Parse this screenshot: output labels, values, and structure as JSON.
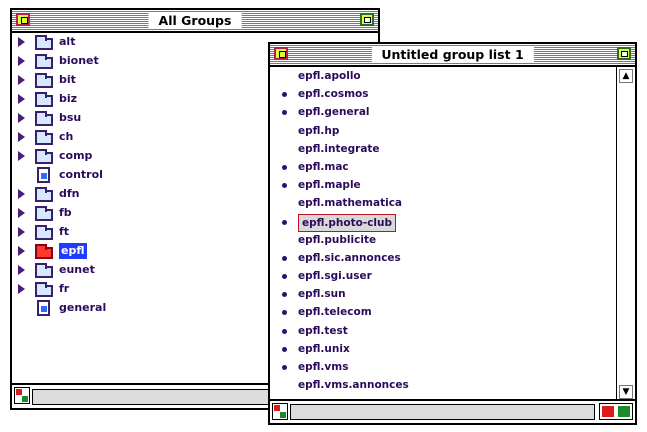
{
  "colors": {
    "list_text": "#2b0a5a",
    "selection_blue": "#1d3cff",
    "close_box_fill": "#d9ff3a",
    "folder_tint": "#d6e8ff",
    "red_folder": "#ff3a2a"
  },
  "all_groups_window": {
    "title": "All Groups",
    "items": [
      {
        "label": "alt",
        "icon": "folder-icon"
      },
      {
        "label": "bionet",
        "icon": "folder-icon"
      },
      {
        "label": "bit",
        "icon": "folder-icon"
      },
      {
        "label": "biz",
        "icon": "folder-icon"
      },
      {
        "label": "bsu",
        "icon": "folder-icon"
      },
      {
        "label": "ch",
        "icon": "folder-icon"
      },
      {
        "label": "comp",
        "icon": "folder-icon"
      },
      {
        "label": "control",
        "icon": "document-icon"
      },
      {
        "label": "dfn",
        "icon": "folder-icon"
      },
      {
        "label": "fb",
        "icon": "folder-icon"
      },
      {
        "label": "ft",
        "icon": "folder-icon"
      },
      {
        "label": "epfl",
        "icon": "folder-icon",
        "selected": true
      },
      {
        "label": "eunet",
        "icon": "folder-icon"
      },
      {
        "label": "fr",
        "icon": "folder-icon"
      },
      {
        "label": "general",
        "icon": "document-icon"
      }
    ]
  },
  "untitled_window": {
    "title": "Untitled group list 1",
    "items": [
      {
        "label": "epfl.apollo"
      },
      {
        "label": "epfl.cosmos",
        "marked": true
      },
      {
        "label": "epfl.general",
        "marked": true
      },
      {
        "label": "epfl.hp"
      },
      {
        "label": "epfl.integrate"
      },
      {
        "label": "epfl.mac",
        "marked": true
      },
      {
        "label": "epfl.maple",
        "marked": true
      },
      {
        "label": "epfl.mathematica"
      },
      {
        "label": "epfl.photo-club",
        "marked": true,
        "selected": true
      },
      {
        "label": "epfl.publicite"
      },
      {
        "label": "epfl.sic.annonces",
        "marked": true
      },
      {
        "label": "epfl.sgi.user",
        "marked": true
      },
      {
        "label": "epfl.sun",
        "marked": true
      },
      {
        "label": "epfl.telecom",
        "marked": true
      },
      {
        "label": "epfl.test",
        "marked": true
      },
      {
        "label": "epfl.unix",
        "marked": true
      },
      {
        "label": "epfl.vms",
        "marked": true
      },
      {
        "label": "epfl.vms.annonces"
      }
    ]
  }
}
